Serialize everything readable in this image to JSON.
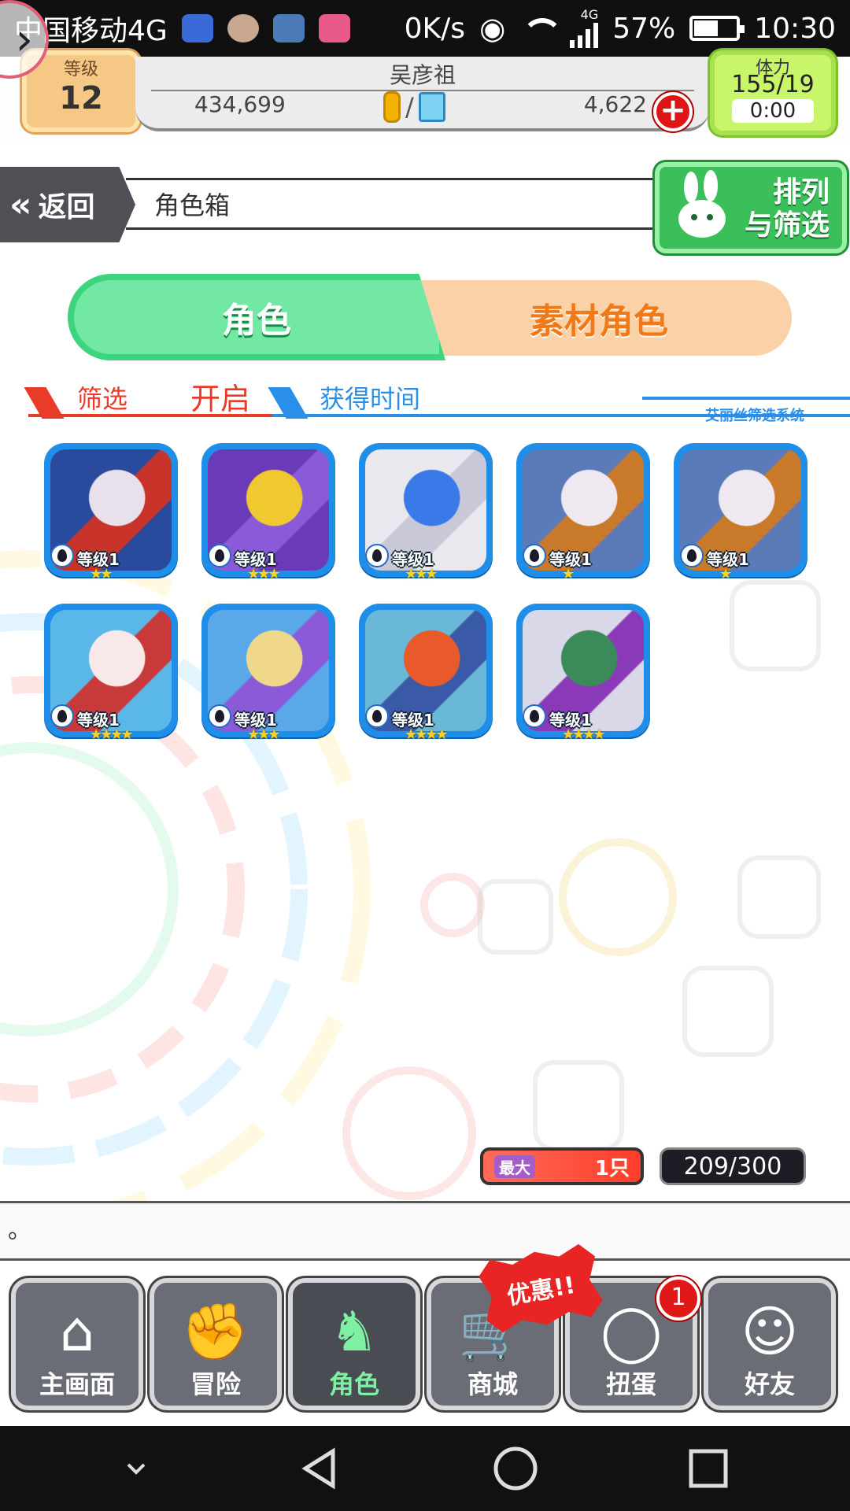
{
  "status_bar": {
    "carrier": "中国移动4G",
    "network_speed": "0K/s",
    "network_type": "4G",
    "battery": "57%",
    "time": "10:30"
  },
  "header": {
    "level_label": "等级",
    "level": "12",
    "player_name": "吴彦祖",
    "coins": "434,699",
    "gems": "4,622",
    "separator": "/",
    "add_label": "+",
    "stamina_label": "体力",
    "stamina": "155/19",
    "stamina_timer": "0:00"
  },
  "titlebar": {
    "back_label": "返回",
    "title": "角色箱",
    "sort_label_line1": "排列",
    "sort_label_line2": "与筛选"
  },
  "tabs": {
    "characters": "角色",
    "materials": "素材角色"
  },
  "filter": {
    "filter_label": "筛选",
    "filter_value": "开启",
    "sort_label": "获得时间",
    "system_hint": "艾丽丝筛选系统"
  },
  "characters": [
    {
      "level": "等级1",
      "stars": "★★",
      "palette": [
        "#2a4a9e",
        "#e8e0ea",
        "#c8342a"
      ]
    },
    {
      "level": "等级1",
      "stars": "★★★",
      "palette": [
        "#6a3ab8",
        "#f0c830",
        "#8a5ad8"
      ]
    },
    {
      "level": "等级1",
      "stars": "★★★",
      "palette": [
        "#e8e8ee",
        "#3a7ae8",
        "#c8c8d8"
      ]
    },
    {
      "level": "等级1",
      "stars": "★",
      "palette": [
        "#5a7ab8",
        "#f0e8f0",
        "#c87a2a"
      ]
    },
    {
      "level": "等级1",
      "stars": "★",
      "palette": [
        "#5a7ab8",
        "#f0e8f0",
        "#c87a2a"
      ]
    },
    {
      "level": "等级1",
      "stars": "★★★★",
      "palette": [
        "#5ab8e8",
        "#f8e8e8",
        "#c83a3a"
      ]
    },
    {
      "level": "等级1",
      "stars": "★★★",
      "palette": [
        "#5aa8e8",
        "#f0d88a",
        "#8a5ad8"
      ]
    },
    {
      "level": "等级1",
      "stars": "★★★★",
      "palette": [
        "#6ab8d8",
        "#e85a2a",
        "#3a5aa8"
      ]
    },
    {
      "level": "等级1",
      "stars": "★★★★",
      "palette": [
        "#d8d8e8",
        "#3a8a5a",
        "#8a3ab8"
      ]
    }
  ],
  "capacity": {
    "max_tag": "最大",
    "max_value": "1只",
    "count": "209/300"
  },
  "message": "。",
  "nav": [
    {
      "label": "主画面",
      "glyph": "⌂",
      "active": false
    },
    {
      "label": "冒险",
      "glyph": "✊",
      "active": false
    },
    {
      "label": "角色",
      "glyph": "♞",
      "active": true
    },
    {
      "label": "商城",
      "glyph": "🛒",
      "active": false
    },
    {
      "label": "扭蛋",
      "glyph": "◯",
      "active": false
    },
    {
      "label": "好友",
      "glyph": "☺",
      "active": false
    }
  ],
  "promo": "优惠!!",
  "gacha_badge": "1",
  "colors": {
    "accent_green": "#3dd47e",
    "accent_orange": "#f07a1a",
    "filter_red": "#e83b2a",
    "filter_blue": "#2a8fe8",
    "card_blue": "#1e8ee8"
  }
}
